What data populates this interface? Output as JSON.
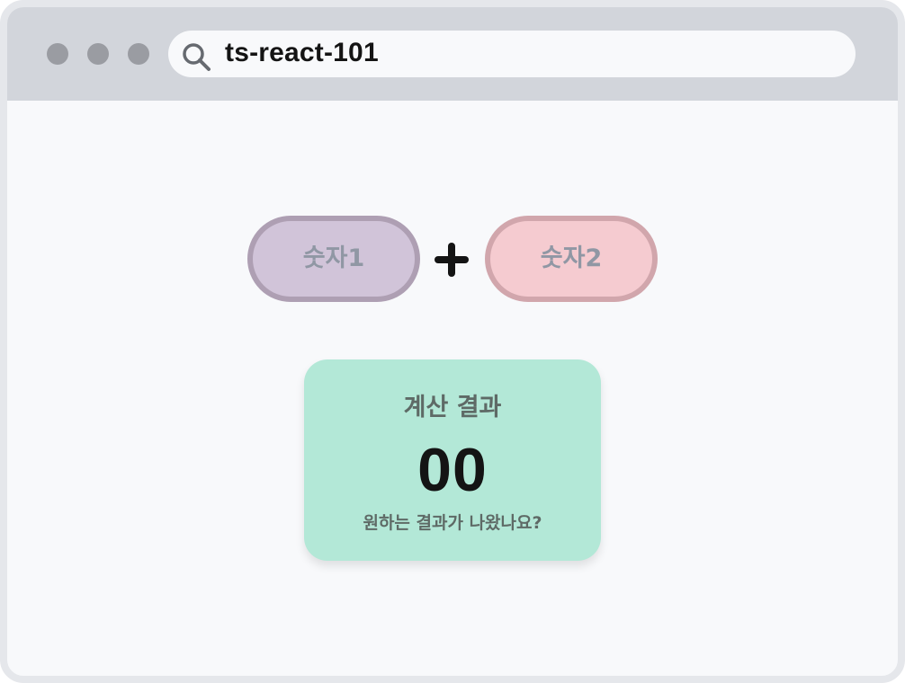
{
  "browser": {
    "address_text": "ts-react-101",
    "icons": {
      "search": "search-icon",
      "window_controls": [
        "window-dot-1",
        "window-dot-2",
        "window-dot-3"
      ]
    }
  },
  "calculator": {
    "input1_label": "숫자1",
    "operator_icon": "plus-icon",
    "input2_label": "숫자2",
    "result": {
      "title": "계산 결과",
      "value": "00",
      "subtitle": "원하는 결과가 나왔나요?"
    }
  },
  "colors": {
    "input1_fill": "#d1c4d9",
    "input1_border": "#ae9fb3",
    "input2_fill": "#f5cbd0",
    "input2_border": "#d1a6ac",
    "result_fill": "#b3e8d7",
    "titlebar": "#d2d5db"
  }
}
